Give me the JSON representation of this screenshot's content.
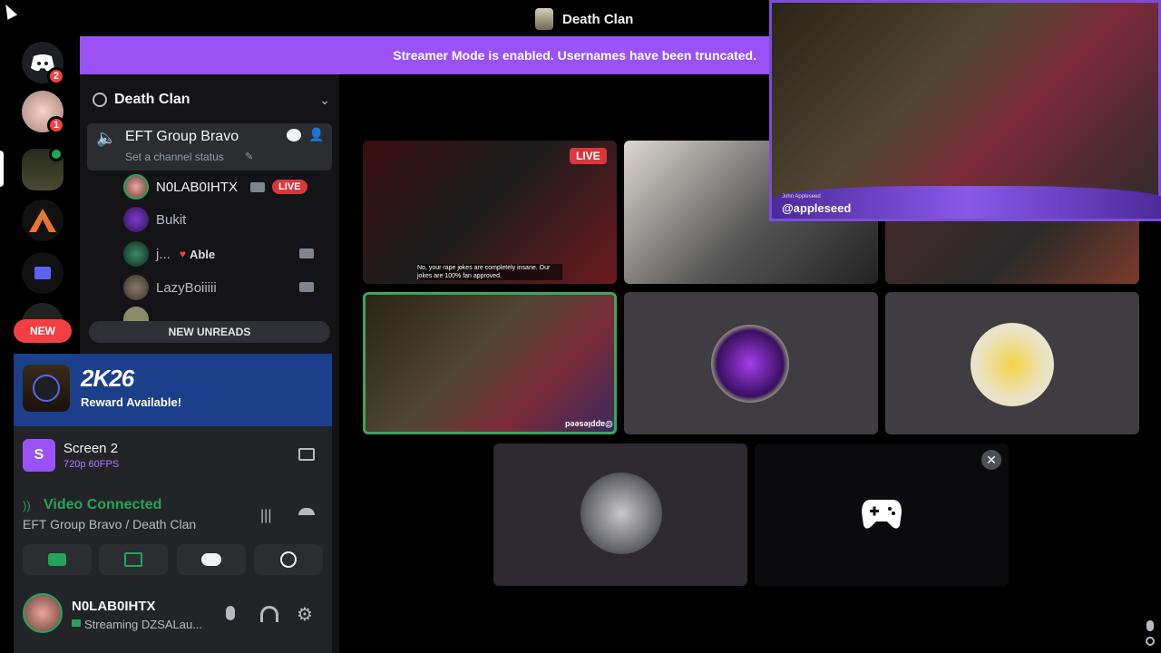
{
  "window": {
    "title": "Death Clan"
  },
  "banner": {
    "text": "Streamer Mode is enabled. Usernames have been truncated."
  },
  "rail": {
    "dm_badge": "2",
    "user_badge": "1",
    "new_label": "NEW"
  },
  "guild": {
    "name": "Death Clan"
  },
  "channel": {
    "name": "EFT Group Bravo",
    "status_placeholder": "Set a channel status"
  },
  "members": [
    {
      "name": "N0LAB0IHTX",
      "live": "LIVE"
    },
    {
      "name": "Bukit"
    },
    {
      "name": "j...",
      "tag": "Able"
    },
    {
      "name": "LazyBoiiiii"
    }
  ],
  "new_unreads": "NEW UNREADS",
  "promo": {
    "title": "2K26",
    "subtitle": "Reward Available!"
  },
  "screen": {
    "name": "Screen 2",
    "quality": "720p 60FPS",
    "icon_letter": "S"
  },
  "voice": {
    "title": "Video Connected",
    "location": "EFT Group Bravo / Death Clan"
  },
  "user": {
    "name": "N0LAB0IHTX",
    "status": "Streaming DZSALau..."
  },
  "grid": {
    "live_tag": "LIVE",
    "caption": "No, your rape jokes are completely insane. Our jokes are 100% fan approved.",
    "cam_handle": "@appleseed",
    "cam_name": "John Appleseed",
    "tile_handle": "@appleseed"
  },
  "colors": {
    "accent": "#9a52f6",
    "live": "#da373c",
    "connected": "#23a559",
    "selected_border": "#3ba55d"
  }
}
